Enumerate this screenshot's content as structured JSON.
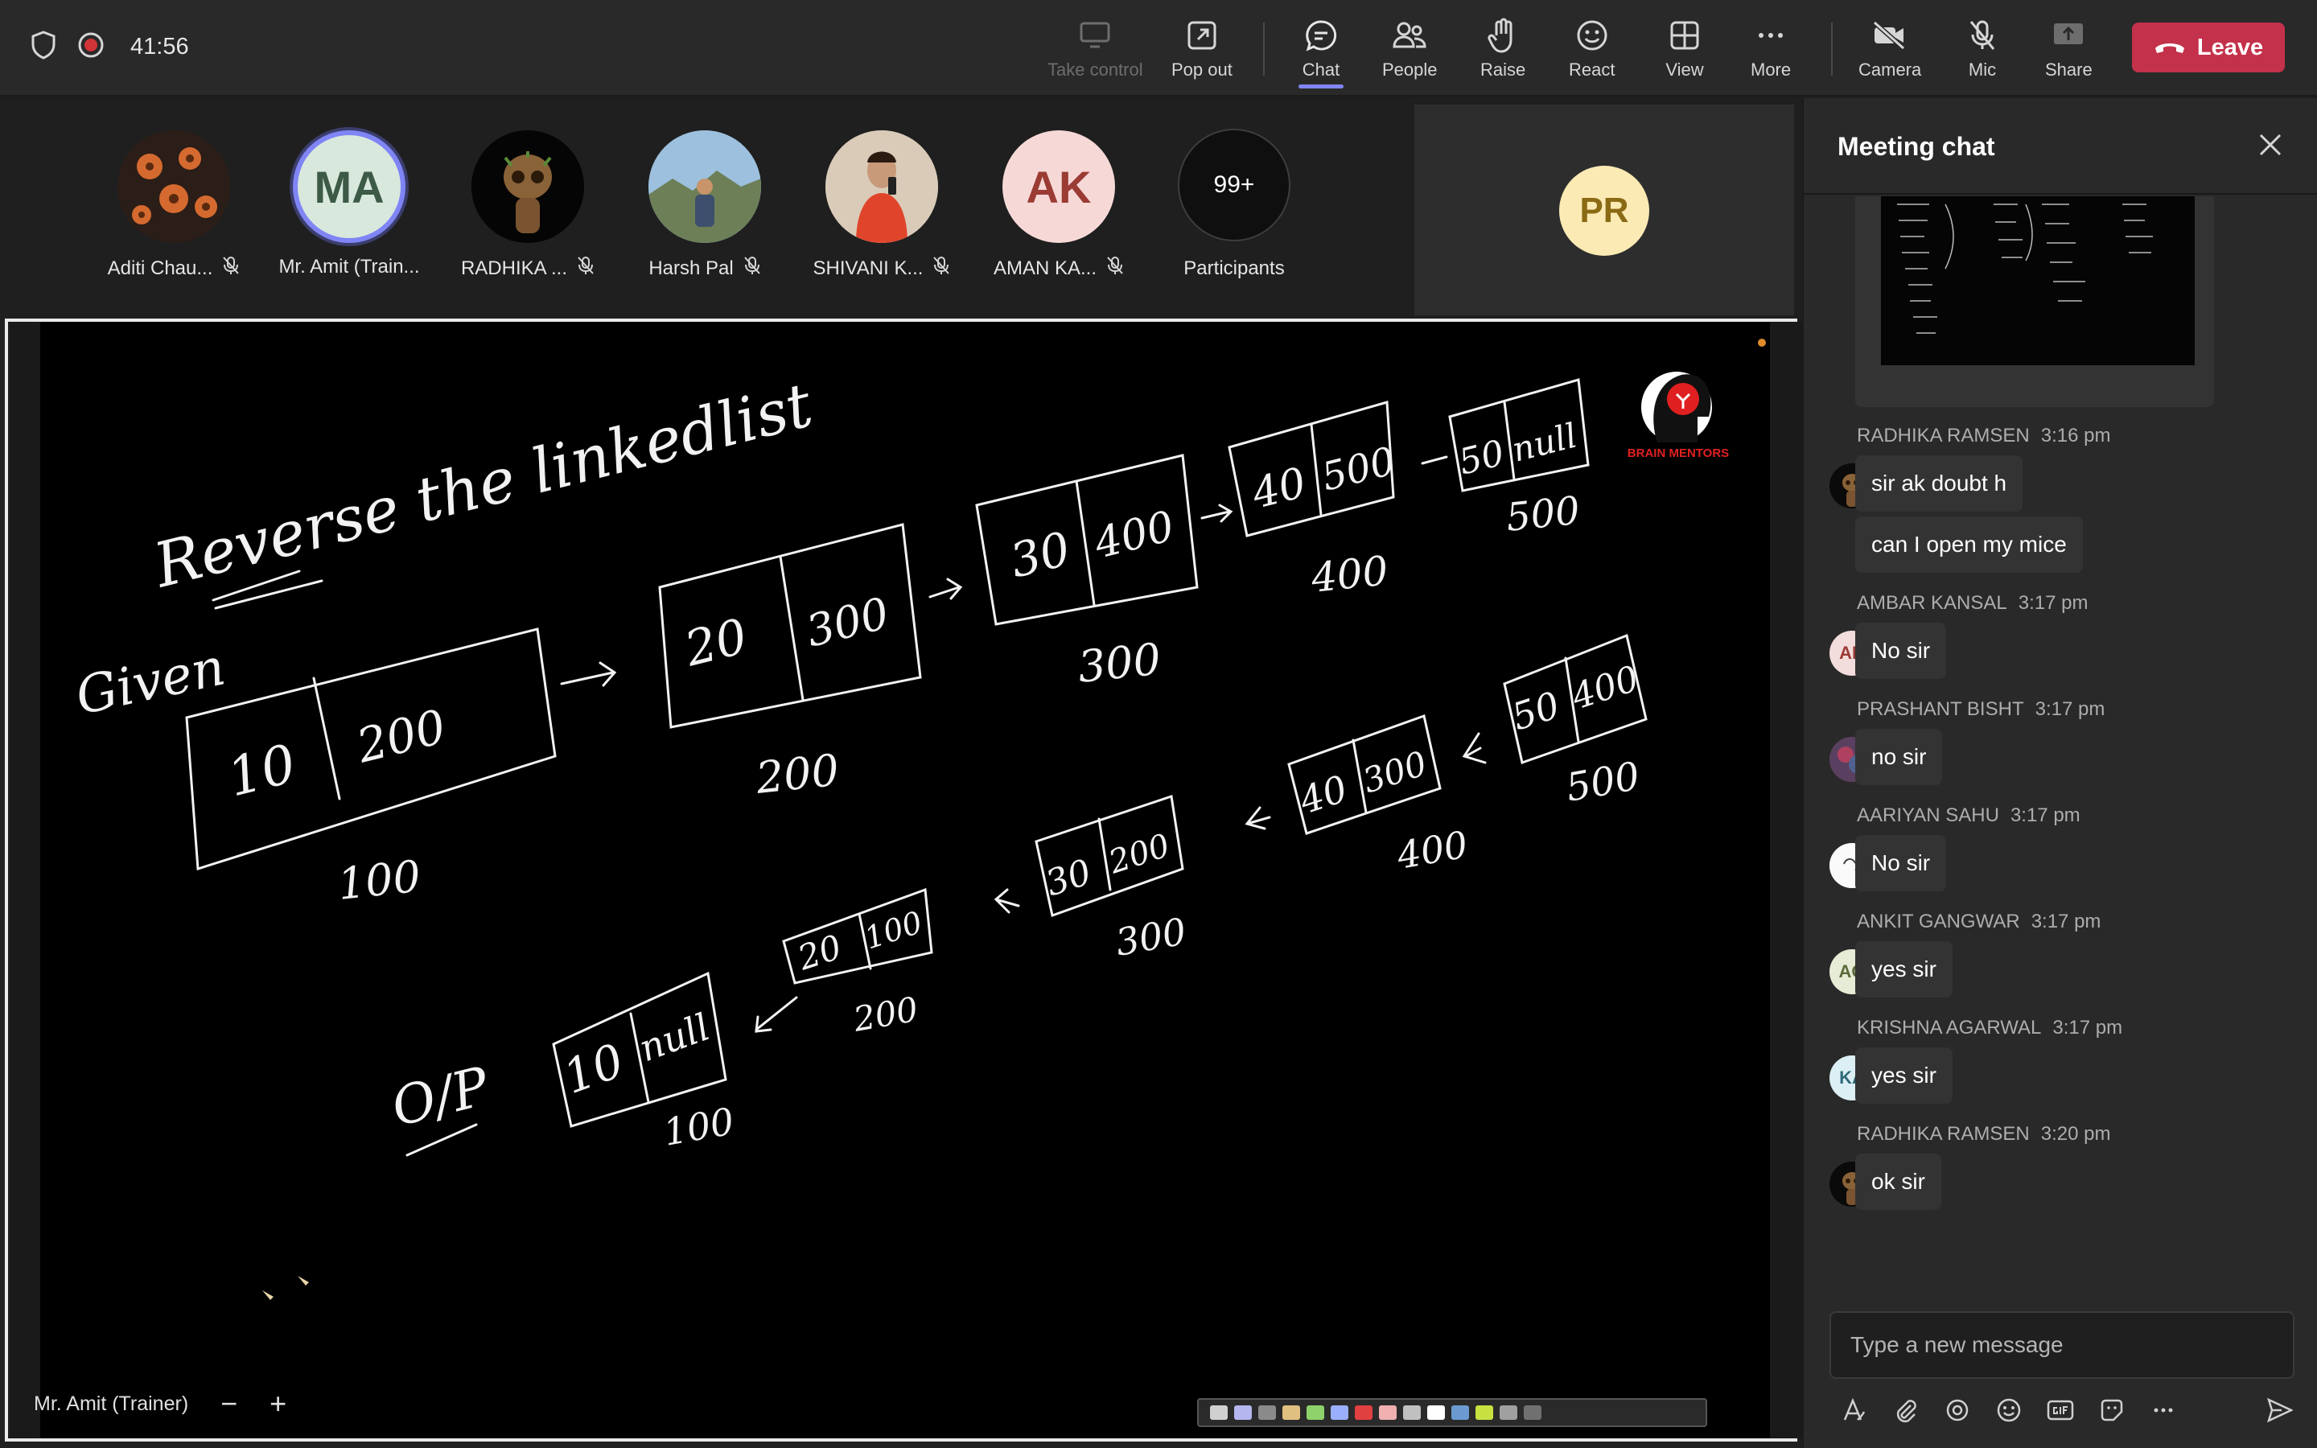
{
  "topbar": {
    "timer": "41:56",
    "buttons": {
      "take_control": "Take control",
      "pop_out": "Pop out",
      "chat": "Chat",
      "people": "People",
      "raise": "Raise",
      "react": "React",
      "view": "View",
      "more": "More",
      "camera": "Camera",
      "mic": "Mic",
      "share": "Share"
    },
    "leave": "Leave"
  },
  "participants": [
    {
      "name": "Aditi Chau...",
      "initials": ""
    },
    {
      "name": "Mr. Amit (Train...",
      "initials": "MA"
    },
    {
      "name": "RADHIKA ...",
      "initials": ""
    },
    {
      "name": "Harsh Pal",
      "initials": ""
    },
    {
      "name": "SHIVANI K...",
      "initials": ""
    },
    {
      "name": "AMAN KA...",
      "initials": "AK"
    }
  ],
  "overflow": {
    "count": "99+",
    "label": "Participants"
  },
  "pr_tile": {
    "initials": "PR"
  },
  "stage": {
    "presenter": "Mr. Amit (Trainer)",
    "logo_text": "BRAIN MENTORS",
    "whiteboard": {
      "title": "Reverse the linkedlist",
      "given": "Given",
      "output": "O/P",
      "given_nodes": [
        {
          "data": "10",
          "next": "200",
          "addr": "100"
        },
        {
          "data": "20",
          "next": "300",
          "addr": "200"
        },
        {
          "data": "30",
          "next": "400",
          "addr": "300"
        },
        {
          "data": "40",
          "next": "500",
          "addr": "400"
        },
        {
          "data": "50",
          "next": "null",
          "addr": "500"
        }
      ],
      "reversed_nodes": [
        {
          "data": "50",
          "next": "400",
          "addr": "500"
        },
        {
          "data": "40",
          "next": "300",
          "addr": "400"
        },
        {
          "data": "30",
          "next": "200",
          "addr": "300"
        },
        {
          "data": "20",
          "next": "100",
          "addr": "200"
        },
        {
          "data": "10",
          "next": "null",
          "addr": "100"
        }
      ]
    },
    "zoom_out": "−",
    "zoom_in": "+"
  },
  "chat": {
    "title": "Meeting chat",
    "messages": [
      {
        "sender": "RADHIKA RAMSEN",
        "time": "3:16 pm",
        "initials": "",
        "texts": [
          "sir ak doubt h",
          "can I open my mice"
        ]
      },
      {
        "sender": "AMBAR KANSAL",
        "time": "3:17 pm",
        "initials": "AK",
        "texts": [
          "No sir"
        ]
      },
      {
        "sender": "PRASHANT BISHT",
        "time": "3:17 pm",
        "initials": "",
        "texts": [
          "no sir"
        ]
      },
      {
        "sender": "AARIYAN SAHU",
        "time": "3:17 pm",
        "initials": "",
        "texts": [
          "No sir"
        ]
      },
      {
        "sender": "ANKIT GANGWAR",
        "time": "3:17 pm",
        "initials": "AG",
        "texts": [
          "yes sir"
        ]
      },
      {
        "sender": "KRISHNA AGARWAL",
        "time": "3:17 pm",
        "initials": "KA",
        "texts": [
          "yes sir"
        ]
      },
      {
        "sender": "RADHIKA RAMSEN",
        "time": "3:20 pm",
        "initials": "",
        "texts": [
          "ok sir"
        ]
      }
    ],
    "compose_placeholder": "Type a new message"
  },
  "colors": {
    "accent": "#7f85f5",
    "leave": "#c4314b",
    "logo_red": "#e02020"
  }
}
